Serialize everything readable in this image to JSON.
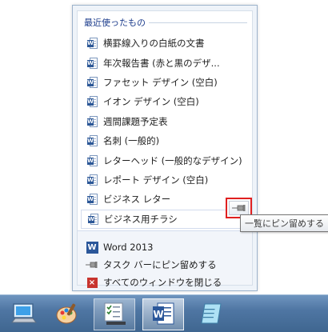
{
  "jump_list": {
    "recent_header": "最近使ったもの",
    "recent_items": [
      "横罫線入りの白紙の文書",
      "年次報告書 (赤と黒のデザ...",
      "ファセット デザイン (空白)",
      "イオン デザイン (空白)",
      "週間課題予定表",
      "名刺 (一般的)",
      "レターヘッド (一般的なデザイン)",
      "レポート デザイン (空白)",
      "ビジネス レター",
      "ビジネス用チラシ"
    ],
    "item_icon": "word-document-icon",
    "pin_icon": "pushpin-icon",
    "tooltip": "一覧にピン留めする",
    "tasks": {
      "app_name": "Word 2013",
      "pin_taskbar": "タスク バーにピン留めする",
      "close_all": "すべてのウィンドウを閉じる"
    }
  },
  "taskbar": {
    "icons": [
      "computer-icon",
      "paint-app-icon",
      "task-list-app-icon",
      "word-app-icon",
      "notepad-icon"
    ]
  },
  "colors": {
    "header_text": "#1c3c8c",
    "highlight_border": "#e02020",
    "word_blue": "#2b579a",
    "close_red": "#c8342e",
    "taskbar": "#4f76a3"
  }
}
